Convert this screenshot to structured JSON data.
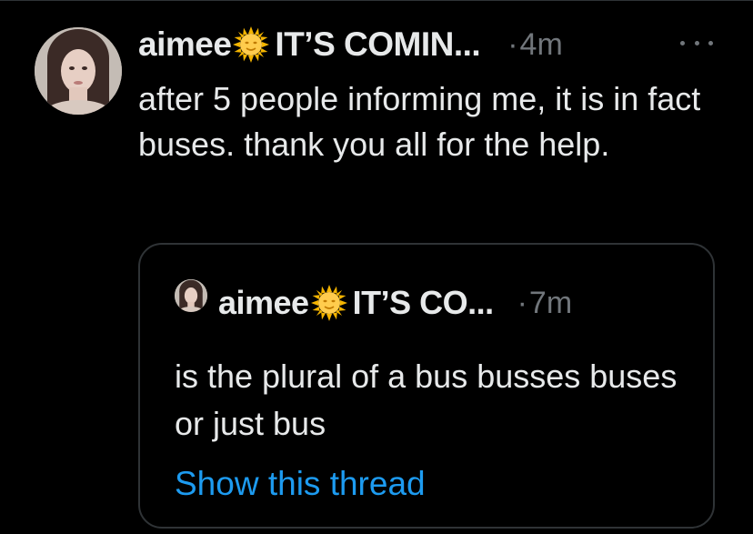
{
  "tweet": {
    "author_name": "aimee",
    "name_emoji": "sun-with-face-icon",
    "display_suffix": "IT’S COMIN...",
    "separator": "·",
    "time": "4m",
    "text": "after 5 people informing me, it is in fact buses. thank you all for the help."
  },
  "quote": {
    "author_name": "aimee",
    "name_emoji": "sun-with-face-icon",
    "display_suffix": "IT’S CO...",
    "separator": "·",
    "time": "7m",
    "text": "is the plural of a bus busses buses or just bus",
    "show_thread": "Show this thread"
  },
  "colors": {
    "background": "#000000",
    "text": "#e7e9ea",
    "muted": "#71767b",
    "border": "#2f3336",
    "link": "#1d9bf0"
  }
}
